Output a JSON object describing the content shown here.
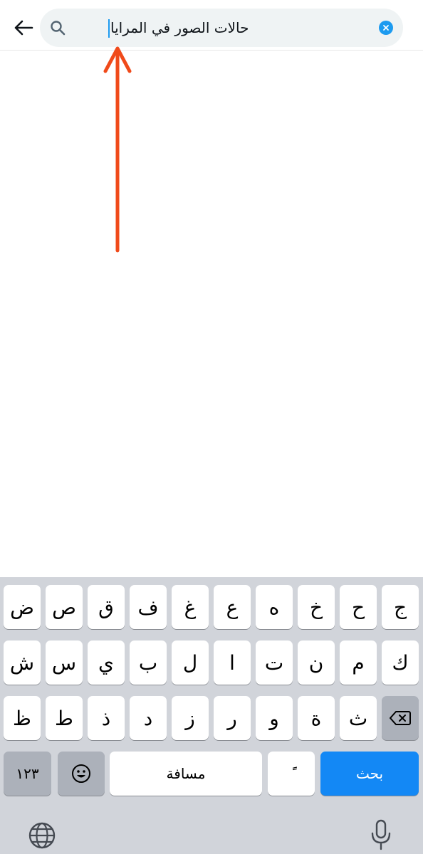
{
  "search": {
    "query": "حالات الصور في المرايا",
    "back_icon": "arrow-left-icon",
    "search_icon": "search-icon",
    "clear_icon": "clear-x-icon"
  },
  "annotation": {
    "color": "#f04a1a",
    "icon": "red-arrow-up"
  },
  "keyboard": {
    "row1": [
      "ج",
      "ح",
      "خ",
      "ه",
      "ع",
      "غ",
      "ف",
      "ق",
      "ص",
      "ض"
    ],
    "row2": [
      "ك",
      "م",
      "ن",
      "ت",
      "ا",
      "ل",
      "ب",
      "ي",
      "س",
      "ش"
    ],
    "row3": [
      "ث",
      "ة",
      "و",
      "ر",
      "ز",
      "د",
      "ذ",
      "ط",
      "ظ"
    ],
    "numbers_label": "١٢٣",
    "space_label": "مسافة",
    "diacritic_label": "ًً",
    "search_label": "بحث",
    "backspace_icon": "backspace-icon",
    "emoji_icon": "emoji-icon",
    "globe_icon": "globe-icon",
    "mic_icon": "microphone-icon"
  },
  "colors": {
    "accent": "#1d9bf0",
    "search_key": "#1388f5",
    "keyboard_bg": "#d1d4da"
  }
}
